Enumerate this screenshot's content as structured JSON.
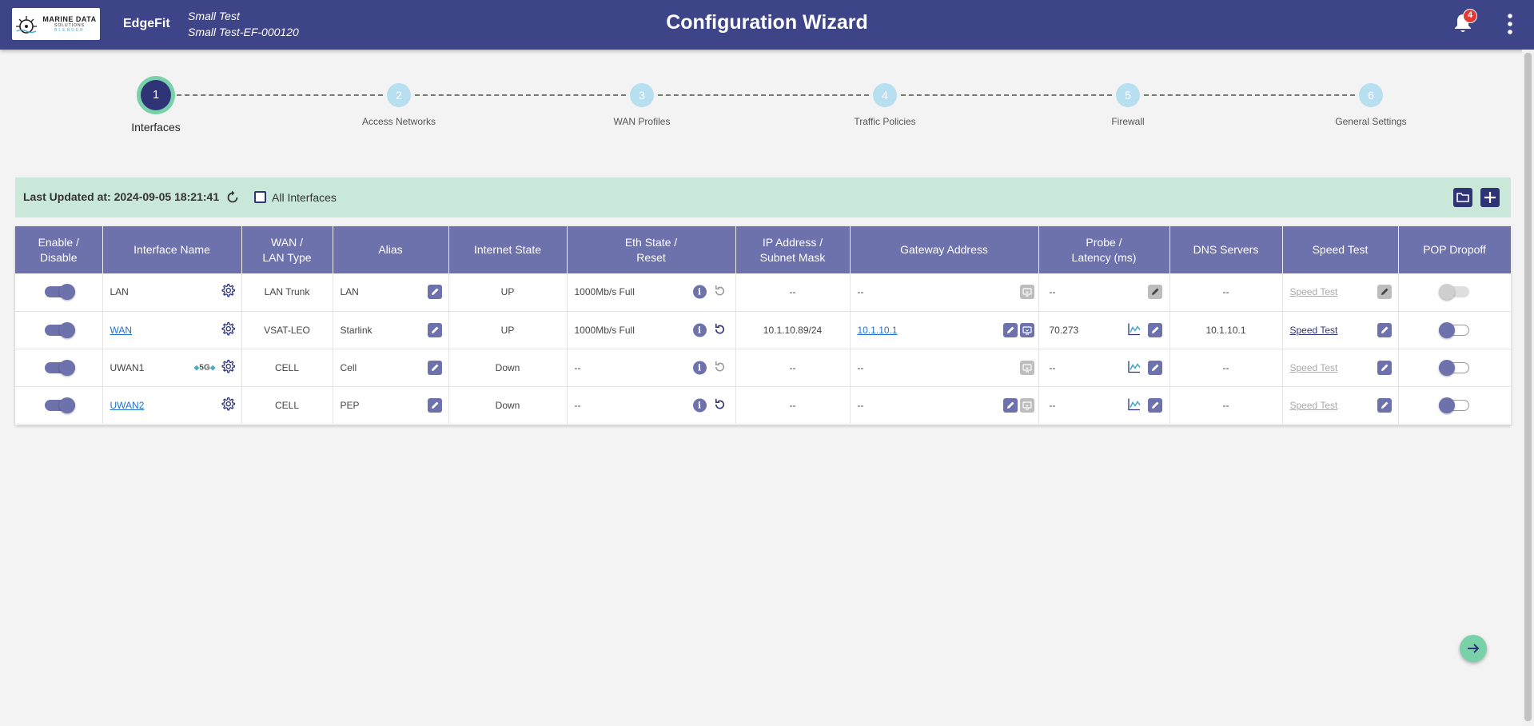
{
  "header": {
    "logo": {
      "line1": "MARINE DATA",
      "line2": "SOLUTIONS",
      "line3": "BLENDER"
    },
    "app_name": "EdgeFit",
    "site_name": "Small Test",
    "site_id": "Small Test-EF-000120",
    "title": "Configuration Wizard",
    "notification_count": "4",
    "icons": {
      "notifications": "bell-icon",
      "menu": "more-vertical-icon"
    }
  },
  "stepper": {
    "steps": [
      {
        "number": "1",
        "label": "Interfaces",
        "active": true
      },
      {
        "number": "2",
        "label": "Access Networks",
        "active": false
      },
      {
        "number": "3",
        "label": "WAN Profiles",
        "active": false
      },
      {
        "number": "4",
        "label": "Traffic Policies",
        "active": false
      },
      {
        "number": "5",
        "label": "Firewall",
        "active": false
      },
      {
        "number": "6",
        "label": "General Settings",
        "active": false
      }
    ]
  },
  "toolbar": {
    "last_updated": "Last Updated at: 2024-09-05 18:21:41",
    "all_interfaces_label": "All Interfaces",
    "all_interfaces_checked": false,
    "icons": {
      "refresh": "refresh-icon",
      "folder": "folder-icon",
      "add": "add-icon"
    }
  },
  "table": {
    "headers": [
      "Enable / Disable",
      "Interface Name",
      "WAN / LAN Type",
      "Alias",
      "Internet State",
      "Eth State / Reset",
      "IP Address / Subnet Mask",
      "Gateway Address",
      "Probe / Latency (ms)",
      "DNS Servers",
      "Speed Test",
      "POP Dropoff"
    ],
    "rows": [
      {
        "enabled": true,
        "name": "LAN",
        "name_link": false,
        "badge_5g": "",
        "type": "LAN Trunk",
        "alias": "LAN",
        "internet_state": "UP",
        "eth_state": "1000Mb/s Full",
        "reset_enabled": false,
        "ip": "--",
        "gateway": "--",
        "gateway_link": false,
        "gateway_editable": false,
        "probe": "--",
        "probe_chart": false,
        "probe_edit_enabled": false,
        "dns": "--",
        "speed_test": "Speed Test",
        "speed_test_enabled": false,
        "speed_edit_enabled": false,
        "pop_dropoff": "disabled"
      },
      {
        "enabled": true,
        "name": "WAN",
        "name_link": true,
        "badge_5g": "",
        "type": "VSAT-LEO",
        "alias": "Starlink",
        "internet_state": "UP",
        "eth_state": "1000Mb/s Full",
        "reset_enabled": true,
        "ip": "10.1.10.89/24",
        "gateway": "10.1.10.1",
        "gateway_link": true,
        "gateway_editable": true,
        "probe": "70.273",
        "probe_chart": true,
        "probe_edit_enabled": true,
        "dns": "10.1.10.1",
        "speed_test": "Speed Test",
        "speed_test_enabled": true,
        "speed_edit_enabled": true,
        "pop_dropoff": "off"
      },
      {
        "enabled": true,
        "name": "UWAN1",
        "name_link": false,
        "badge_5g": "5G",
        "type": "CELL",
        "alias": "Cell",
        "internet_state": "Down",
        "eth_state": "--",
        "reset_enabled": false,
        "ip": "--",
        "gateway": "--",
        "gateway_link": false,
        "gateway_editable": false,
        "probe": "--",
        "probe_chart": true,
        "probe_edit_enabled": true,
        "dns": "--",
        "speed_test": "Speed Test",
        "speed_test_enabled": false,
        "speed_edit_enabled": true,
        "pop_dropoff": "off"
      },
      {
        "enabled": true,
        "name": "UWAN2",
        "name_link": true,
        "badge_5g": "",
        "type": "CELL",
        "alias": "PEP",
        "internet_state": "Down",
        "eth_state": "--",
        "reset_enabled": true,
        "ip": "--",
        "gateway": "--",
        "gateway_link": false,
        "gateway_editable": true,
        "probe": "--",
        "probe_chart": true,
        "probe_edit_enabled": true,
        "dns": "--",
        "speed_test": "Speed Test",
        "speed_test_enabled": false,
        "speed_edit_enabled": true,
        "pop_dropoff": "off"
      }
    ]
  },
  "footer": {
    "icons": {
      "next": "arrow-right-icon"
    }
  },
  "colors": {
    "header_bg": "#3e4488",
    "primary": "#6d72ac",
    "accent": "#79d1aa",
    "toolbar_bg": "#c9e8da",
    "link": "#1f72d2",
    "step_inactive": "#b7dff0"
  }
}
